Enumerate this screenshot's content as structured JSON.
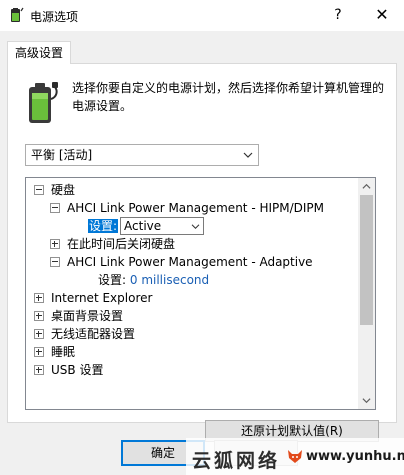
{
  "window": {
    "title": "电源选项",
    "help_label": "?",
    "close_label": "✕"
  },
  "tab": {
    "label": "高级设置"
  },
  "description": "选择你要自定义的电源计划，然后选择你希望计算机管理的电源设置。",
  "plan_select": {
    "value": "平衡 [活动]"
  },
  "tree": {
    "disk": "硬盘",
    "hipm": "AHCI Link Power Management - HIPM/DIPM",
    "hipm_setting_label": "设置:",
    "hipm_setting_value": "Active",
    "turn_off_disk": "在此时间后关闭硬盘",
    "adaptive": "AHCI Link Power Management - Adaptive",
    "adaptive_setting_label": "设置:",
    "adaptive_setting_value": "0 millisecond",
    "ie": "Internet Explorer",
    "desktop_bg": "桌面背景设置",
    "wireless": "无线适配器设置",
    "sleep": "睡眠",
    "usb": "USB 设置"
  },
  "buttons": {
    "restore": "还原计划默认值(R)",
    "ok": "确定"
  },
  "watermark": {
    "cn": "云狐网络",
    "url": "www.yunhu.net"
  },
  "colors": {
    "selection": "#0078d7",
    "link": "#1a5fb4",
    "battery": "#6abf3b"
  },
  "icons": {
    "app": "power-options-icon",
    "battery": "battery-plug-icon"
  }
}
